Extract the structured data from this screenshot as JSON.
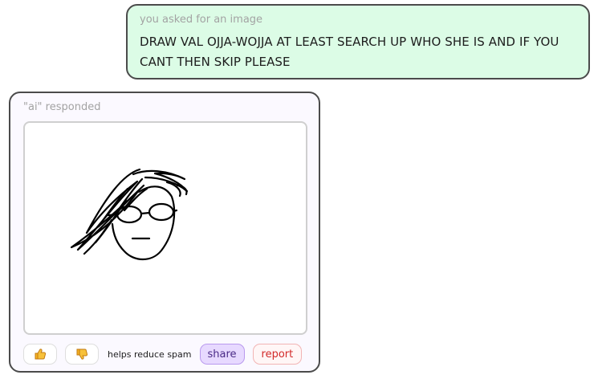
{
  "request": {
    "label": "you asked for an image",
    "text": "DRAW VAL OJJA-WOJJA AT LEAST SEARCH UP WHO SHE IS AND IF YOU CANT THEN SKIP PLEASE"
  },
  "response": {
    "label": "\"ai\" responded",
    "image_alt": "rough black line sketch of a face with glasses and messy hair"
  },
  "actions": {
    "like_icon": "thumbs-up-icon",
    "dislike_icon": "thumbs-down-icon",
    "helps_text": "helps reduce spam",
    "share_label": "share",
    "report_label": "report"
  },
  "colors": {
    "request_bg": "#dcfce6",
    "card_bg": "#fbf9ff",
    "share_bg": "#e7d9ff",
    "report_text": "#d22a2a"
  }
}
